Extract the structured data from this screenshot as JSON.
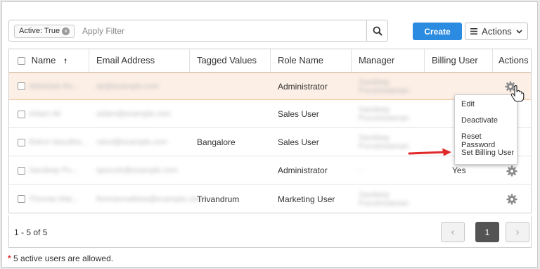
{
  "filter": {
    "chip_label": "Active: True",
    "placeholder": "Apply Filter"
  },
  "toolbar": {
    "create_label": "Create",
    "actions_label": "Actions"
  },
  "table": {
    "columns": [
      "Name",
      "Email Address",
      "Tagged Values",
      "Role Name",
      "Manager",
      "Billing User",
      "Actions"
    ],
    "rows": [
      {
        "name": "Abhishek Ro...",
        "email": "ab@example.com",
        "tagged": "",
        "role": "Administrator",
        "manager": "Sandeep Purushotaman",
        "billing": ""
      },
      {
        "name": "Aslam Ali",
        "email": "aslam@example.com",
        "tagged": "",
        "role": "Sales User",
        "manager": "Sandeep Purushotaman",
        "billing": ""
      },
      {
        "name": "Rahul Vasudha...",
        "email": "rahul@example.com",
        "tagged": "Bangalore",
        "role": "Sales User",
        "manager": "Sandeep Purushotaman",
        "billing": ""
      },
      {
        "name": "Sandeep Pu...",
        "email": "spurush@example.com",
        "tagged": "",
        "role": "Administrator",
        "manager": "-",
        "billing": "Yes"
      },
      {
        "name": "Thomas Mat...",
        "email": "thomasmathew@example.com",
        "tagged": "Trivandrum",
        "role": "Marketing User",
        "manager": "Sandeep Purushotaman",
        "billing": ""
      }
    ]
  },
  "menu": {
    "items": [
      "Edit",
      "Deactivate",
      "Reset Password",
      "Set Billing User"
    ]
  },
  "pagination": {
    "summary": "1 - 5 of 5",
    "current_page": "1",
    "prev_glyph": "‹",
    "next_glyph": "›"
  },
  "note": {
    "star": "*",
    "text": " 5 active users are allowed."
  },
  "colors": {
    "accent": "#2b8be0",
    "selected_row": "#fcefe6",
    "arrow": "#e0282a"
  }
}
